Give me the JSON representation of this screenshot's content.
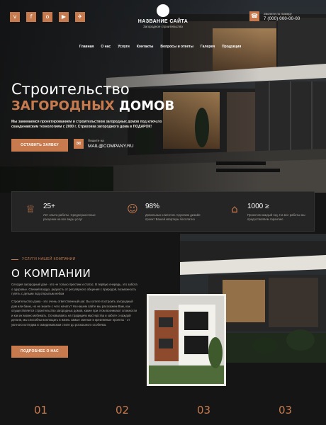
{
  "header": {
    "socials": [
      {
        "icon": "vk-icon",
        "glyph": "v"
      },
      {
        "icon": "facebook-icon",
        "glyph": "f"
      },
      {
        "icon": "odnoklassniki-icon",
        "glyph": "o"
      },
      {
        "icon": "youtube-icon",
        "glyph": "▶"
      },
      {
        "icon": "telegram-icon",
        "glyph": "✈"
      }
    ],
    "logo": {
      "name": "НАЗВАНИЕ САЙТА",
      "subtitle": "Загородное строительство"
    },
    "phone": {
      "caption": "Звоните по номеру",
      "number": "7 (000) 000-00-00",
      "icon": "phone-icon"
    }
  },
  "nav": [
    "Главная",
    "О нас",
    "Услуги",
    "Контакты",
    "Вопросы и ответы",
    "Галерея",
    "Продукция"
  ],
  "hero": {
    "title_line1": "Строительство",
    "title_accent": "ЗАГОРОДНЫХ",
    "title_rest": "ДОМОВ",
    "description": "Мы занимаемся проектированием и строительством загородных домов под ключ,по скандинавским технологиям с 2000 г. Страховка загородного дома в ПОДАРОК!",
    "cta": "ОСТАВИТЬ ЗАЯВКУ",
    "mail_caption": "Пишите на",
    "mail_address": "MAIL@COMPANY.RU"
  },
  "features": [
    {
      "icon": "medal-icon",
      "glyph": "♕",
      "number": "25+",
      "text": "Лет опыта работы. Среднерыночные расценки на все виды услуг"
    },
    {
      "icon": "team-icon",
      "glyph": "☺",
      "number": "98%",
      "text": "Довольных клиентов. Сделаем дизайн-проект Вашей квартиры бесплатно"
    },
    {
      "icon": "house-icon",
      "glyph": "⌂",
      "number": "1000 ≥",
      "text": "Проектов каждый год. На все работы мы предоставляем гарантию"
    }
  ],
  "about": {
    "label": "УСЛУГИ НАШЕЙ КОМПАНИИ",
    "title": "О КОМПАНИИ",
    "p1": "Сегодня загородный дом - это не только престиж и статус. В первую очередь, это забота о здоровье. Свежий воздух, редкость от регулярного общения с природой, возможность гулять с детьми под открытым небом",
    "p2": "Строительство дома - это очень ответственный шаг. Вы хотите построить загородный дом или баню, но не знаете с чего начать? На нашем сайте мы расскажем Вам, как осуществляется строительство загородных домов, какие при этом возникают сложности и как их можно избежать. Основываясь на традициях мастерства и заботе о каждой детали, мы способны воплощать в жизнь самые смелые и креативные проекты - от уютного коттеджа в скандинавском стиле до роскошного особняка.",
    "button": "ПОДРОБНЕЕ О НАС"
  },
  "steps": [
    "01",
    "02",
    "03",
    "03"
  ],
  "colors": {
    "accent": "#c77a4e",
    "background": "#151515",
    "panel": "#252525"
  }
}
